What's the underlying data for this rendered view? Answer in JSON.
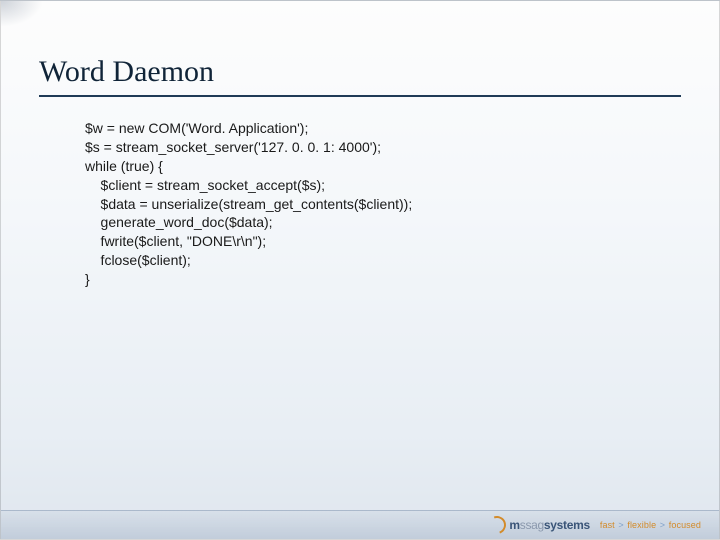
{
  "slide": {
    "title": "Word Daemon",
    "code": "$w = new COM('Word. Application');\n$s = stream_socket_server('127. 0. 0. 1: 4000');\nwhile (true) {\n    $client = stream_socket_accept($s);\n    $data = unserialize(stream_get_contents($client));\n    generate_word_doc($data);\n    fwrite($client, \"DONE\\r\\n\");\n    fclose($client);\n}"
  },
  "footer": {
    "brand_prefix": "m",
    "brand_mid": "ssag",
    "brand_suffix": "systems",
    "tagline_fast": "fast",
    "tagline_flexible": "flexible",
    "tagline_focused": "focused"
  }
}
